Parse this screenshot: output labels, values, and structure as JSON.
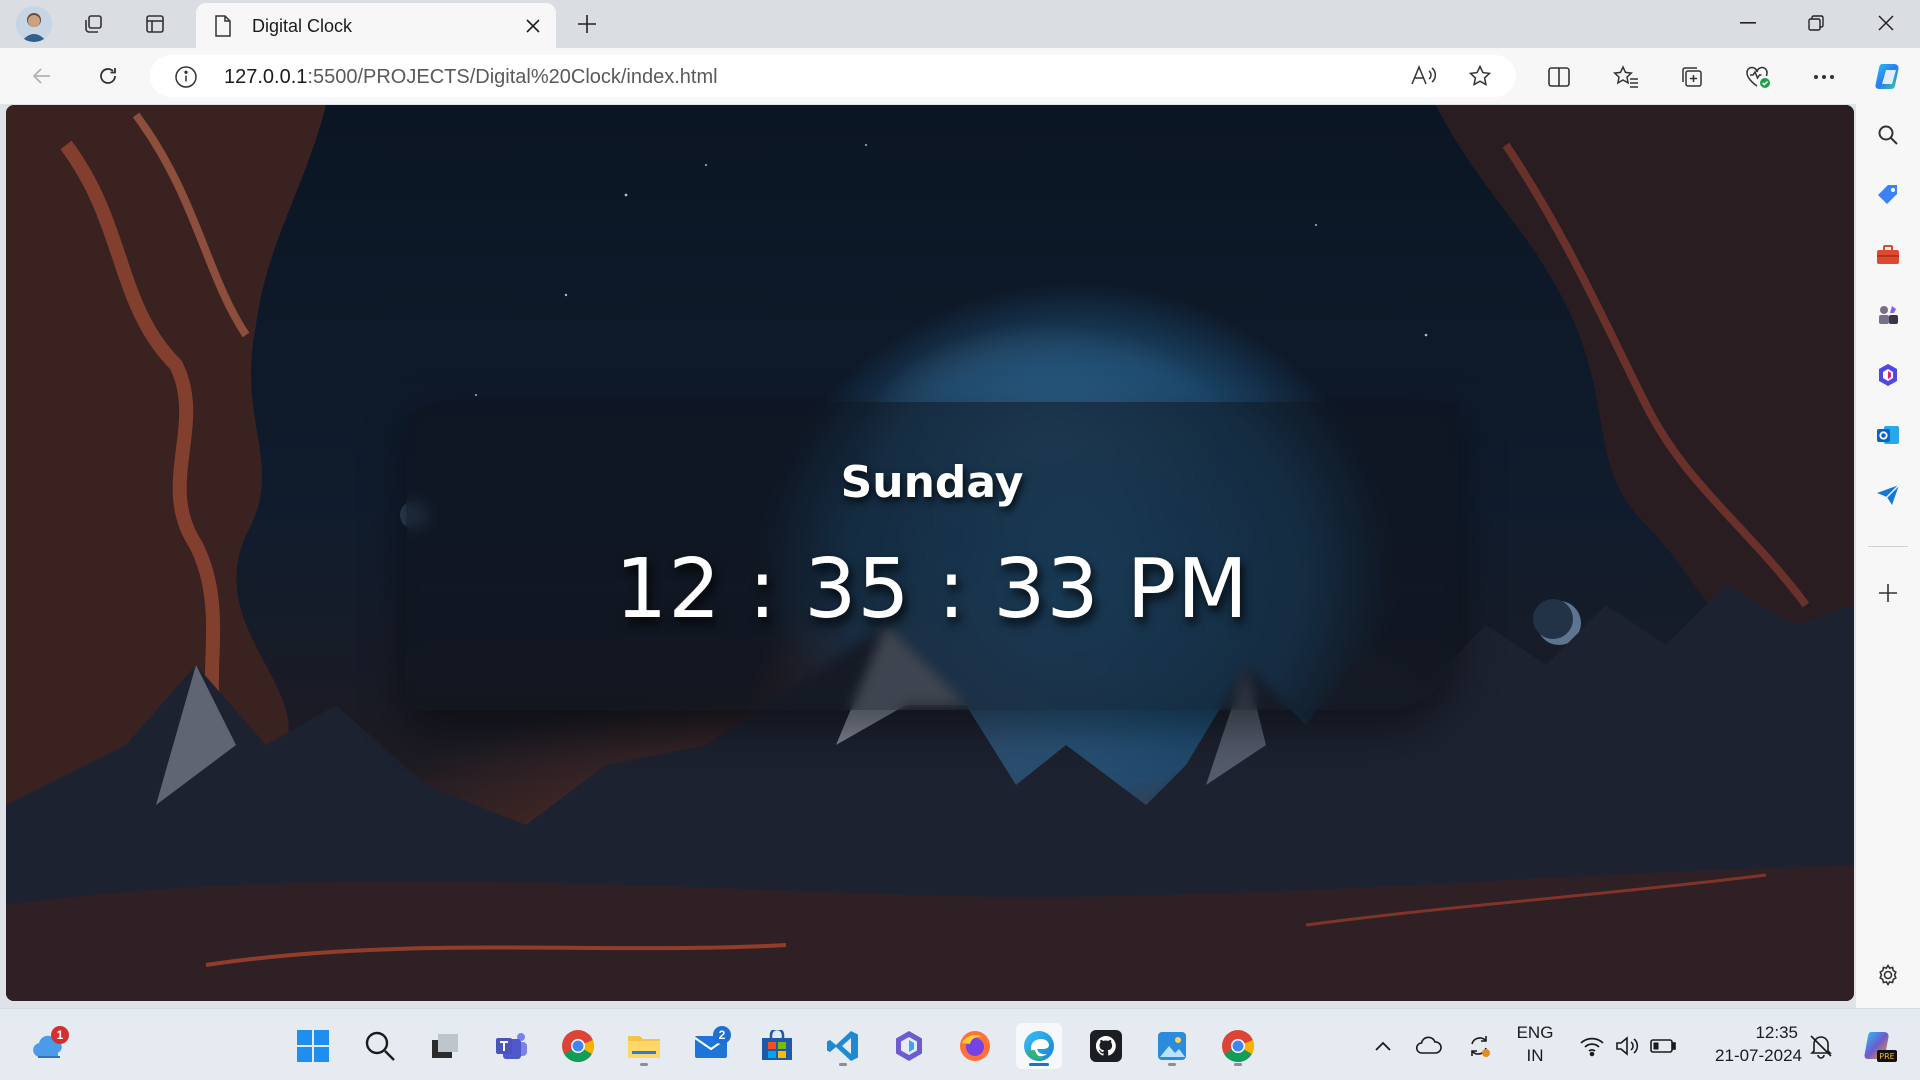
{
  "browser": {
    "tab_title": "Digital Clock",
    "url_host": "127.0.0.1",
    "url_rest": ":5500/PROJECTS/Digital%20Clock/index.html"
  },
  "clock": {
    "day": "Sunday",
    "time": "12 : 35 : 33 PM"
  },
  "taskbar": {
    "weather_badge": "1",
    "mail_badge": "2",
    "language_line1": "ENG",
    "language_line2": "IN",
    "clock_time": "12:35",
    "clock_date": "21-07-2024"
  },
  "colors": {
    "accent_blue": "#1f6fd1",
    "badge_red": "#d32f2f",
    "badge_blue": "#1f6fd1"
  }
}
